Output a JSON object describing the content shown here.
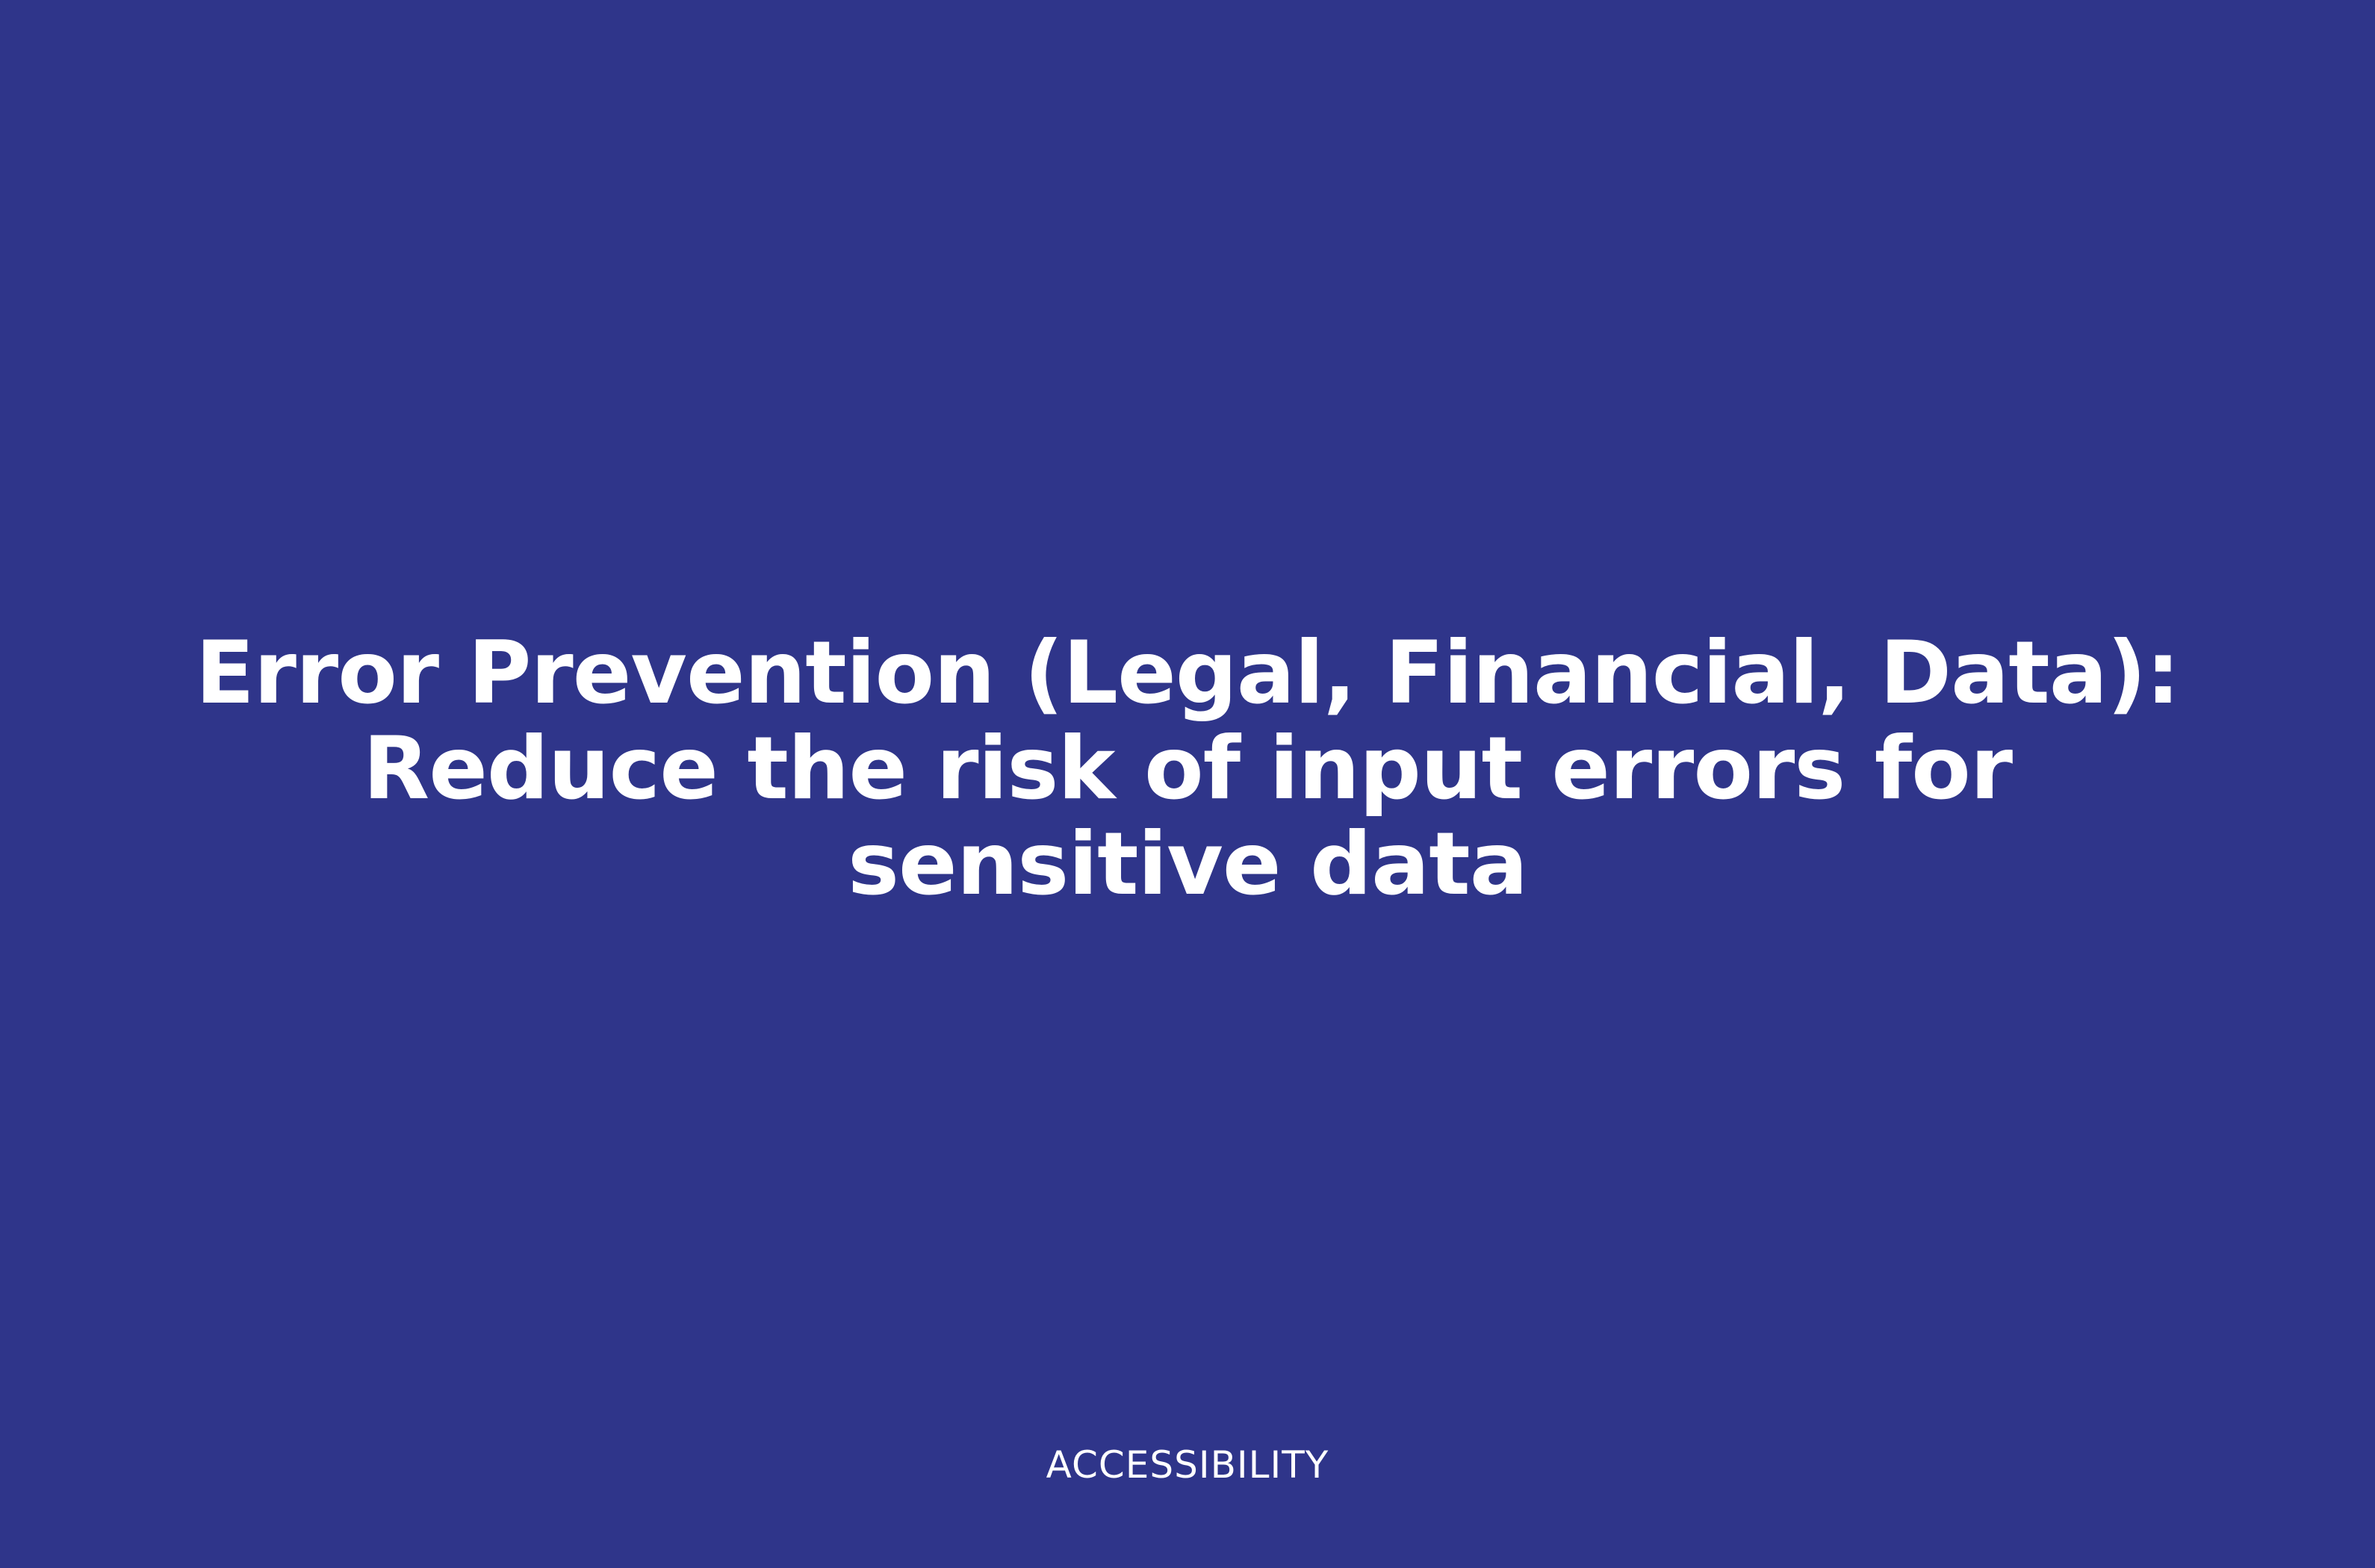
{
  "slide": {
    "title_lines": [
      "Error Prevention (Legal, Financial, Data):",
      "Reduce the risk of input errors for",
      "sensitive data"
    ],
    "footer_label": "ACCESSIBILITY"
  },
  "colors": {
    "background": "#2f358a",
    "text": "#ffffff"
  }
}
